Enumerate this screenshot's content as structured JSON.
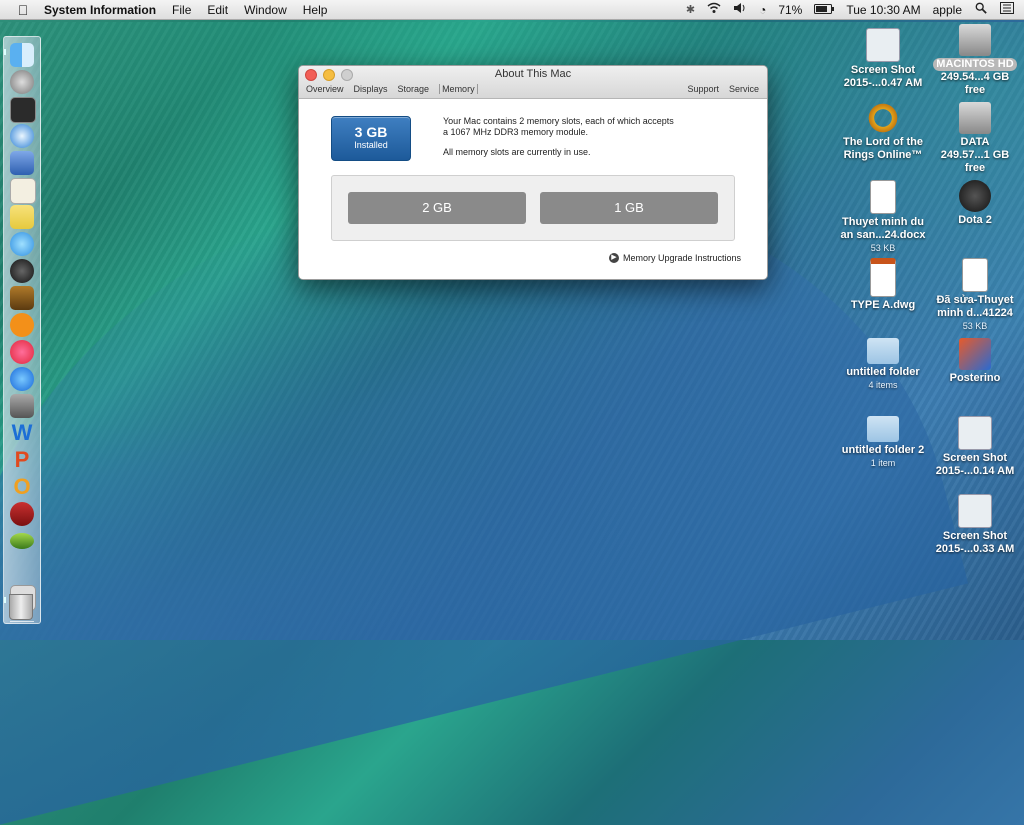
{
  "menubar": {
    "app_name": "System Information",
    "menus": [
      "File",
      "Edit",
      "Window",
      "Help"
    ],
    "battery": "71%",
    "clock": "Tue 10:30 AM",
    "user": "apple"
  },
  "window": {
    "title": "About This Mac",
    "tabs": [
      "Overview",
      "Displays",
      "Storage",
      "Memory"
    ],
    "active_tab": "Memory",
    "right_tabs": [
      "Support",
      "Service"
    ],
    "installed": {
      "amount": "3 GB",
      "label": "Installed"
    },
    "description_line1": "Your Mac contains 2 memory slots, each of which accepts",
    "description_line2": "a 1067 MHz DDR3 memory module.",
    "description_line3": "All memory slots are currently in use.",
    "slots": [
      "2 GB",
      "1 GB"
    ],
    "upgrade_link": "Memory Upgrade Instructions"
  },
  "desktop": {
    "screenshot1": {
      "line1": "Screen Shot",
      "line2": "2015-...0.47 AM"
    },
    "hd": {
      "line1": "MACINTOS HD",
      "line2": "249.54...4 GB free"
    },
    "lotro": {
      "line1": "The Lord of the",
      "line2": "Rings Online™"
    },
    "data": {
      "line1": "DATA",
      "line2": "249.57...1 GB free"
    },
    "docx1": {
      "line1": "Thuyet minh du",
      "line2": "an san...24.docx",
      "sub": "53 KB"
    },
    "dota": {
      "line1": "Dota 2"
    },
    "dwg": {
      "line1": "TYPE A.dwg"
    },
    "docx2": {
      "line1": "Đã sửa-Thuyet",
      "line2": "minh d...41224",
      "sub": "53 KB"
    },
    "folder1": {
      "line1": "untitled folder",
      "sub": "4 items"
    },
    "posterino": {
      "line1": "Posterino"
    },
    "folder2": {
      "line1": "untitled folder 2",
      "sub": "1 item"
    },
    "screenshot2": {
      "line1": "Screen Shot",
      "line2": "2015-...0.14 AM"
    },
    "screenshot3": {
      "line1": "Screen Shot",
      "line2": "2015-...0.33 AM"
    }
  }
}
